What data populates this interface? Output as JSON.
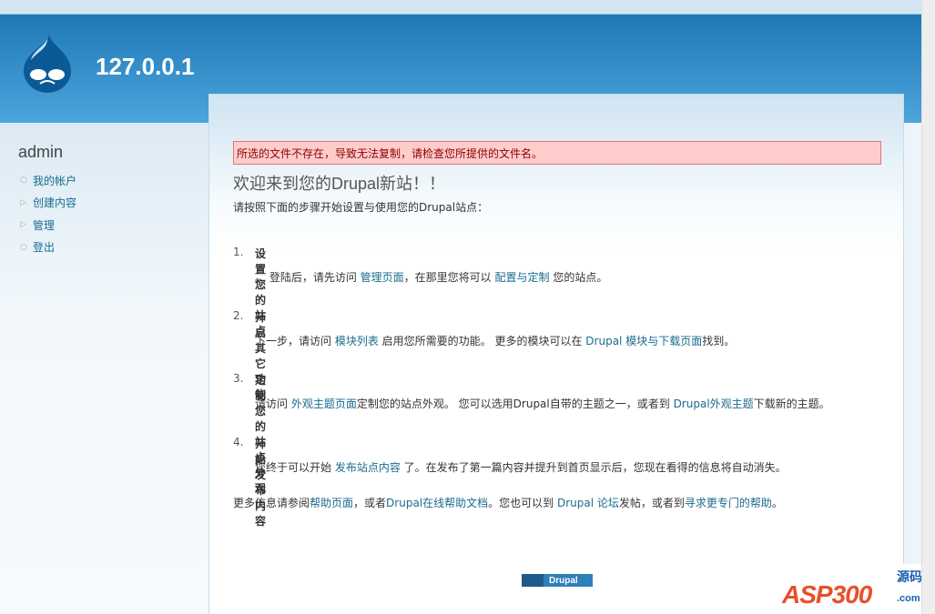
{
  "site": {
    "name": "127.0.0.1"
  },
  "sidebar": {
    "title": "admin",
    "items": [
      {
        "label": "我的帐户",
        "bullet": "○"
      },
      {
        "label": "创建内容",
        "bullet": "▷"
      },
      {
        "label": "管理",
        "bullet": "▷"
      },
      {
        "label": "登出",
        "bullet": "○"
      }
    ]
  },
  "main": {
    "error": "所选的文件不存在，导致无法复制，请检查您所提供的文件名。",
    "title": "欢迎来到您的Drupal新站！！",
    "intro": "请按照下面的步骤开始设置与使用您的Drupal站点：",
    "steps": [
      {
        "num": "1.",
        "heading": "设置您的站点",
        "parts": [
          "。  登陆后，请先访问 ",
          "管理页面",
          "，在那里您将可以 ",
          "配置与定制",
          "  您的站点。"
        ]
      },
      {
        "num": "2.",
        "heading": "开启其它功能",
        "parts": [
          "下一步，请访问 ",
          "模块列表",
          "  启用您所需要的功能。 更多的模块可以在 ",
          "Drupal 模块与下载页面",
          "找到。"
        ]
      },
      {
        "num": "3.",
        "heading": "定制您的站点外观",
        "parts": [
          "请访问 ",
          "外观主题页面",
          "定制您的站点外观。 您可以选用Drupal自带的主题之一，或者到 ",
          "Drupal外观主题",
          "下载新的主题。"
        ]
      },
      {
        "num": "4.",
        "heading": "开始发布内容",
        "parts": [
          "您终于可以开始 ",
          "发布站点内容",
          "  了。在发布了第一篇内容并提升到首页显示后，您现在看得的信息将自动消失。"
        ]
      }
    ],
    "more": [
      "更多信息请参阅",
      "帮助页面",
      "，或者",
      "Drupal在线帮助文档",
      "。您也可以到 ",
      "Drupal 论坛",
      "发帖，或者到",
      "寻求更专门的帮助",
      "。"
    ]
  },
  "footer": {
    "powered": "Drupal"
  },
  "watermark": {
    "text": "ASP300",
    "cn": "源码",
    "domain": ".com"
  }
}
